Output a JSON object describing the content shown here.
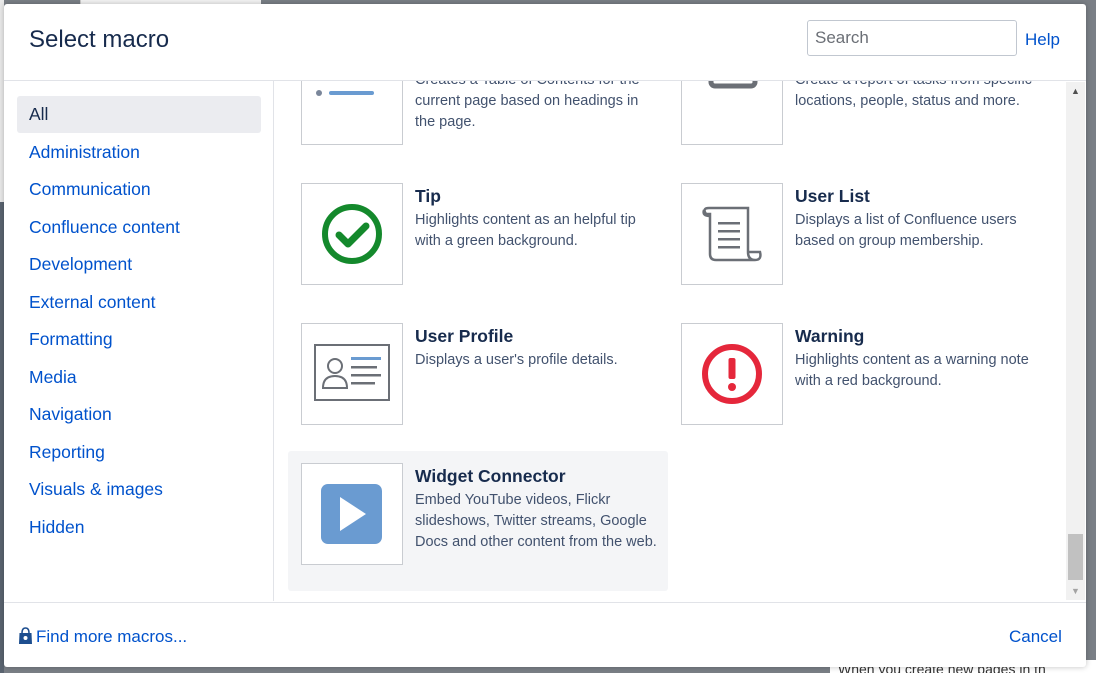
{
  "background": {
    "bottom_text": "When you create new pages in th"
  },
  "dialog": {
    "title": "Select macro",
    "search_placeholder": "Search",
    "help_label": "Help"
  },
  "sidebar": {
    "categories": [
      {
        "label": "All",
        "active": true
      },
      {
        "label": "Administration"
      },
      {
        "label": "Communication"
      },
      {
        "label": "Confluence content"
      },
      {
        "label": "Development"
      },
      {
        "label": "External content"
      },
      {
        "label": "Formatting"
      },
      {
        "label": "Media"
      },
      {
        "label": "Navigation"
      },
      {
        "label": "Reporting"
      },
      {
        "label": "Visuals & images"
      },
      {
        "label": "Hidden"
      }
    ]
  },
  "macros": [
    {
      "name": "",
      "description": "Creates a Table of Contents for the current page based on headings in the page.",
      "icon": "table-of-contents-icon"
    },
    {
      "name": "",
      "description": "Create a report of tasks from specific locations, people, status and more.",
      "icon": "task-report-icon"
    },
    {
      "name": "Tip",
      "description": "Highlights content as an helpful tip with a green background.",
      "icon": "tip-check-icon"
    },
    {
      "name": "User List",
      "description": "Displays a list of Confluence users based on group membership.",
      "icon": "scroll-list-icon"
    },
    {
      "name": "User Profile",
      "description": "Displays a user's profile details.",
      "icon": "profile-card-icon"
    },
    {
      "name": "Warning",
      "description": "Highlights content as a warning note with a red background.",
      "icon": "warning-exclamation-icon"
    },
    {
      "name": "Widget Connector",
      "description": "Embed YouTube videos, Flickr slideshows, Twitter streams, Google Docs and other content from the web.",
      "icon": "play-icon",
      "highlighted": true
    }
  ],
  "footer": {
    "find_more_label": "Find more macros...",
    "cancel_label": "Cancel"
  },
  "colors": {
    "link": "#0052cc",
    "text": "#172b4d",
    "tip_green": "#14892c",
    "warning_red": "#e5273b",
    "play_blue": "#6a9bd1"
  }
}
